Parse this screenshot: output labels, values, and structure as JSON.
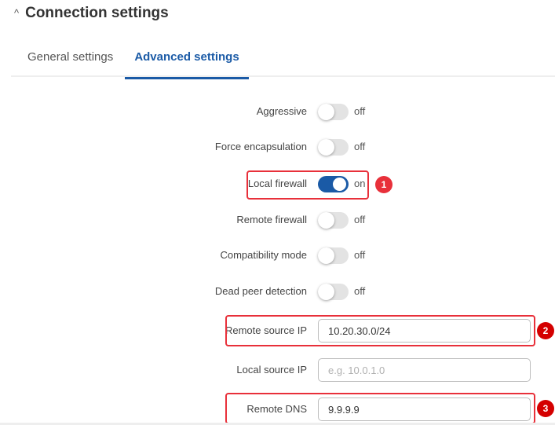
{
  "section": {
    "title": "Connection settings",
    "collapse_icon": "chevron-up-icon"
  },
  "tabs": [
    {
      "label": "General settings",
      "active": false
    },
    {
      "label": "Advanced settings",
      "active": true
    }
  ],
  "toggles": [
    {
      "label": "Aggressive",
      "value": false,
      "state_text": "off"
    },
    {
      "label": "Force encapsulation",
      "value": false,
      "state_text": "off"
    },
    {
      "label": "Local firewall",
      "value": true,
      "state_text": "on"
    },
    {
      "label": "Remote firewall",
      "value": false,
      "state_text": "off"
    },
    {
      "label": "Compatibility mode",
      "value": false,
      "state_text": "off"
    },
    {
      "label": "Dead peer detection",
      "value": false,
      "state_text": "off"
    }
  ],
  "fields": [
    {
      "label": "Remote source IP",
      "value": "10.20.30.0/24",
      "placeholder": ""
    },
    {
      "label": "Local source IP",
      "value": "",
      "placeholder": "e.g. 10.0.1.0"
    },
    {
      "label": "Remote DNS",
      "value": "9.9.9.9",
      "placeholder": ""
    }
  ],
  "annotations": {
    "colors": {
      "highlight": "#e8303a",
      "badge": "#e8303a",
      "toggle_on": "#1a5aa6"
    },
    "badges": [
      "1",
      "2",
      "3"
    ]
  }
}
